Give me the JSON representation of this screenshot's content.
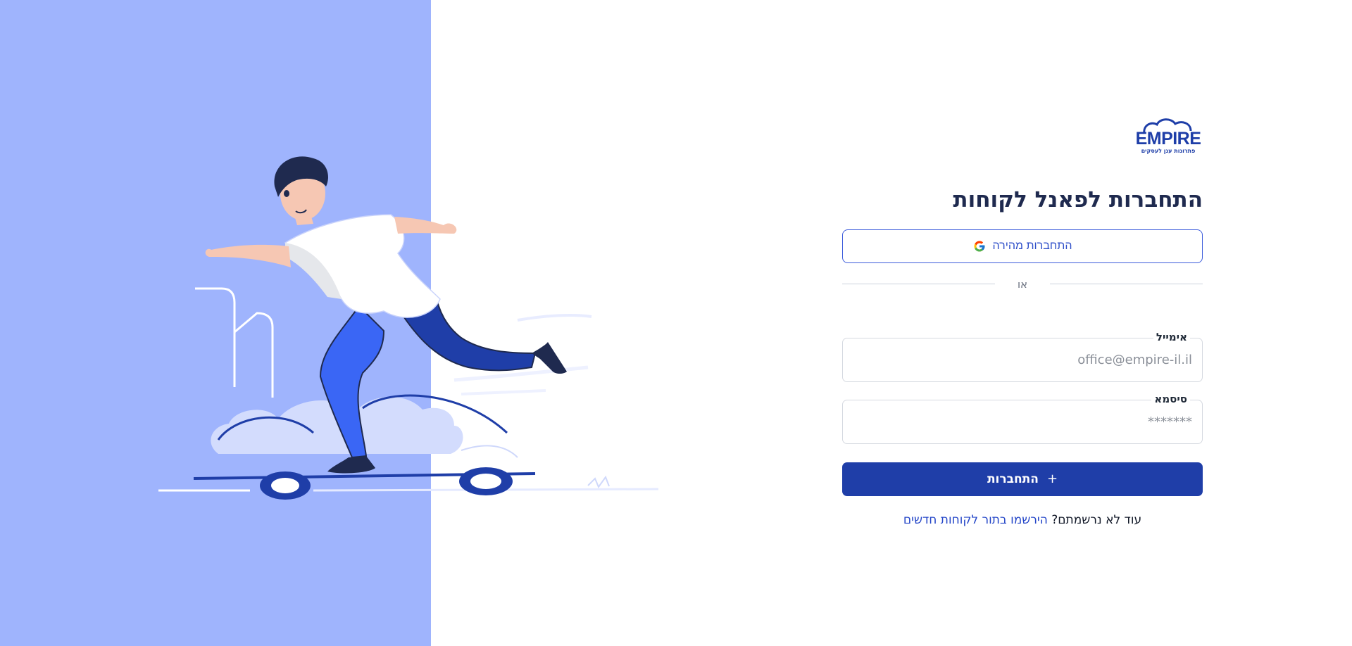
{
  "brand": {
    "name": "EMPIRE",
    "tagline": "פתרונות ענן לעסקים",
    "primary_color": "#1f3ea8",
    "illustration_bg": "#9fb4fd"
  },
  "login": {
    "title": "התחברות לפאנל לקוחות",
    "google_button_label": "התחברות מהירה",
    "google_icon": "google-icon",
    "divider_text": "או",
    "email_label": "אימייל",
    "email_placeholder": "office@empire-il.il",
    "email_value": "",
    "password_label": "סיסמא",
    "password_placeholder": "*******",
    "password_value": "",
    "submit_label": "התחברות",
    "submit_icon": "plus-icon",
    "signup_prompt": "עוד לא נרשמתם?",
    "signup_link": "הירשמו בתור לקוחות חדשים"
  }
}
